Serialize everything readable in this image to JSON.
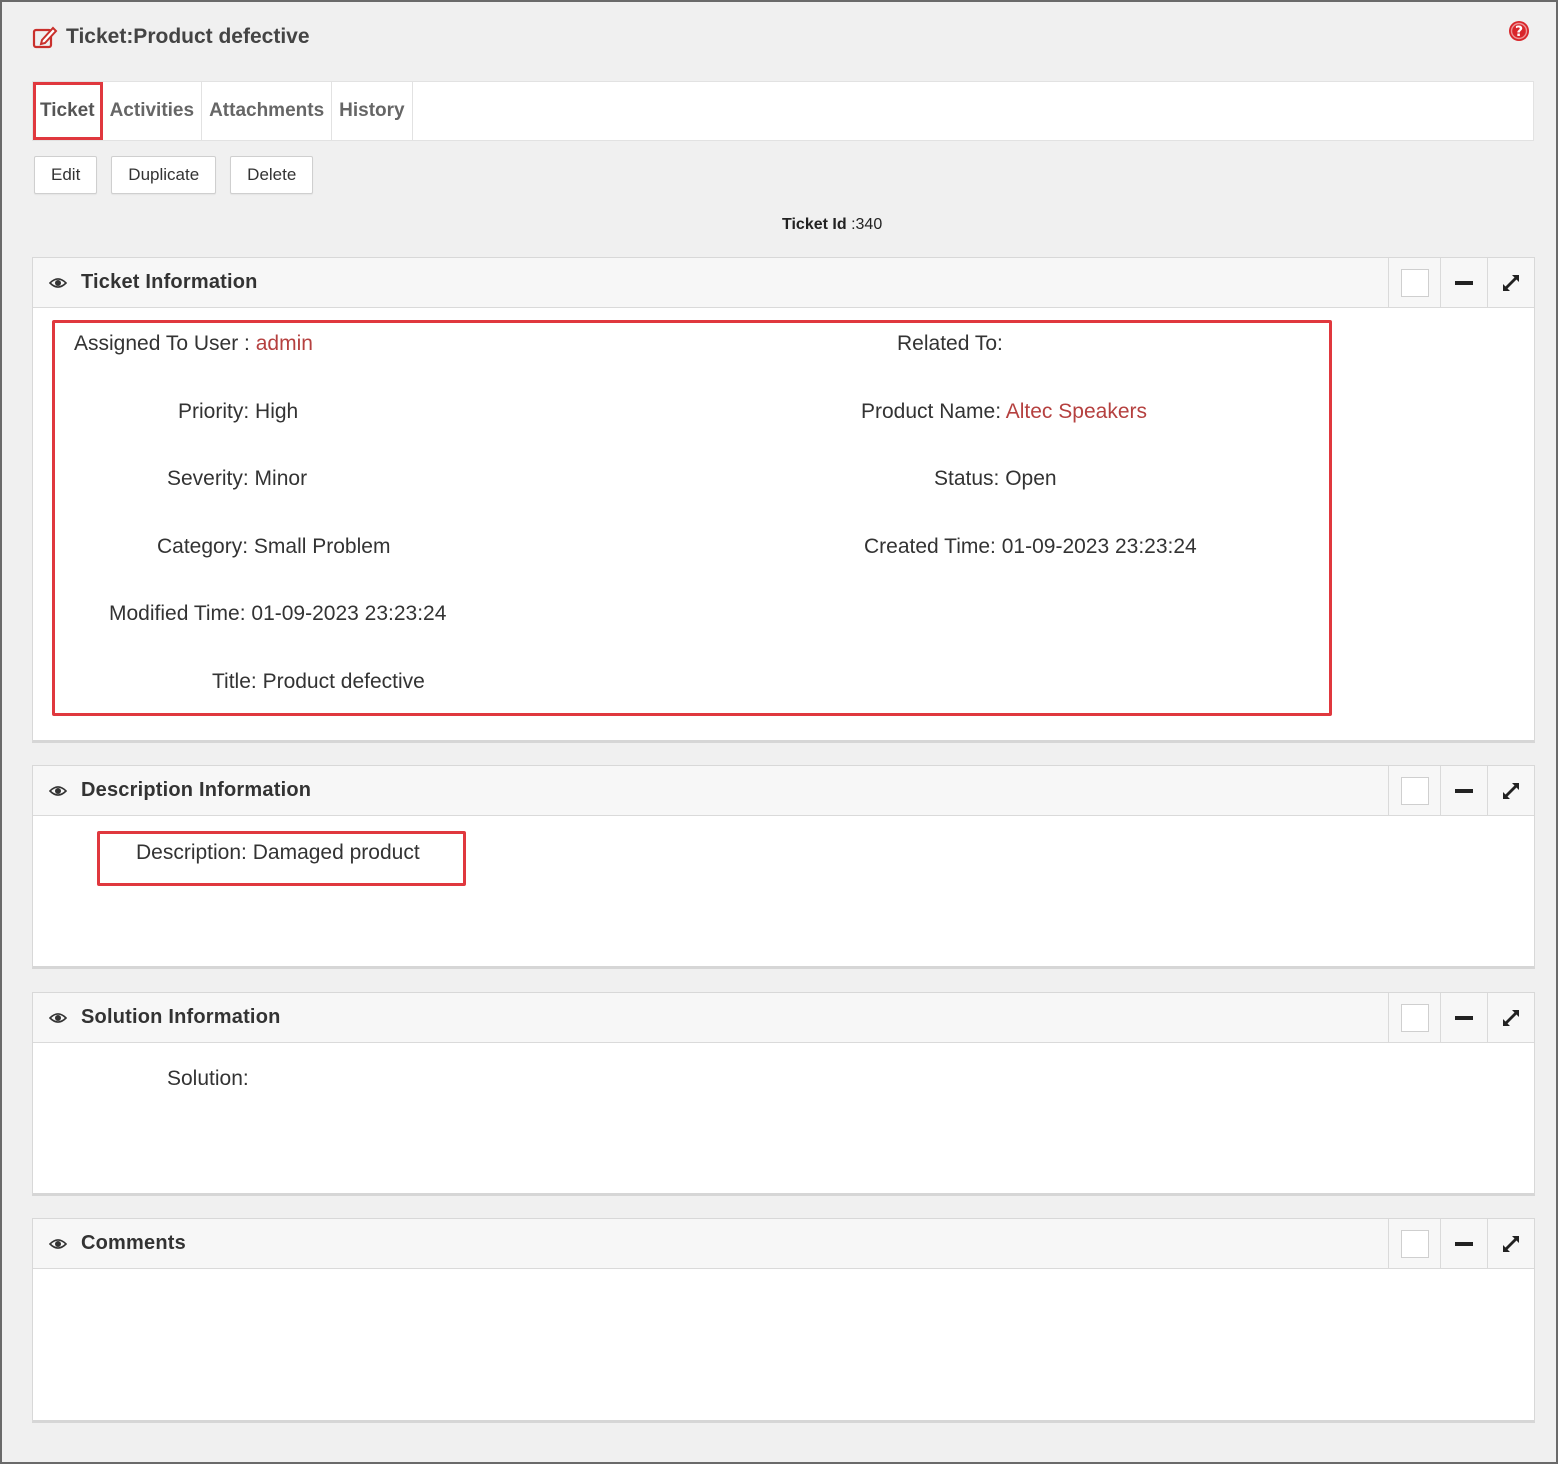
{
  "header": {
    "title": "Ticket:Product defective"
  },
  "tabs": [
    {
      "label": "Ticket",
      "active": true
    },
    {
      "label": "Activities"
    },
    {
      "label": "Attachments"
    },
    {
      "label": "History"
    }
  ],
  "actions": {
    "edit": "Edit",
    "duplicate": "Duplicate",
    "delete": "Delete"
  },
  "ticket_id": {
    "label": "Ticket Id",
    "value": ":340"
  },
  "panels": {
    "ticket_info": {
      "title": "Ticket Information",
      "fields": {
        "assigned_label": "Assigned To User :",
        "assigned_value": "admin",
        "related_label": "Related To:",
        "priority_label": "Priority:",
        "priority_value": "High",
        "product_label": "Product Name:",
        "product_value": "Altec Speakers",
        "severity_label": "Severity:",
        "severity_value": "Minor",
        "status_label": "Status:",
        "status_value": "Open",
        "category_label": "Category:",
        "category_value": "Small Problem",
        "created_label": "Created Time:",
        "created_value": "01-09-2023 23:23:24",
        "modified_label": "Modified Time:",
        "modified_value": "01-09-2023 23:23:24",
        "title_label": "Title:",
        "title_value": "Product defective"
      }
    },
    "description": {
      "title": "Description Information",
      "label": "Description:",
      "value": "Damaged product"
    },
    "solution": {
      "title": "Solution Information",
      "label": "Solution:"
    },
    "comments": {
      "title": "Comments"
    }
  },
  "colors": {
    "accent_red": "#e0383e",
    "link": "#b5403f"
  },
  "icons": [
    "edit-icon",
    "help-icon",
    "eye-icon",
    "checkbox-icon",
    "minus-icon",
    "expand-icon"
  ]
}
